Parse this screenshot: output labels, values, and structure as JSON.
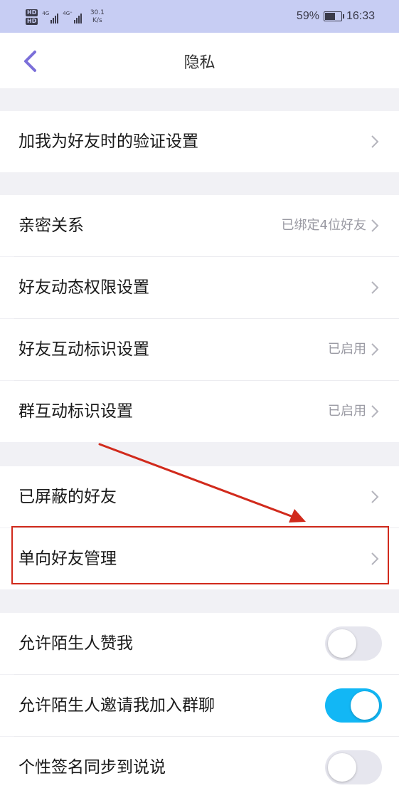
{
  "status_bar": {
    "hd1": "HD",
    "hd2": "HD",
    "sig1_label": "4G",
    "sig2_label": "4G⁺",
    "speed_value": "30.1",
    "speed_unit": "K/s",
    "battery_percent": "59%",
    "battery_level": 0.59,
    "time": "16:33"
  },
  "nav": {
    "back_icon": "chevron-left-icon",
    "title": "隐私"
  },
  "sections": [
    {
      "rows": [
        {
          "label": "加我为好友时的验证设置",
          "value": "",
          "control": "chevron"
        }
      ]
    },
    {
      "rows": [
        {
          "label": "亲密关系",
          "value": "已绑定4位好友",
          "control": "chevron"
        },
        {
          "label": "好友动态权限设置",
          "value": "",
          "control": "chevron"
        },
        {
          "label": "好友互动标识设置",
          "value": "已启用",
          "control": "chevron"
        },
        {
          "label": "群互动标识设置",
          "value": "已启用",
          "control": "chevron"
        }
      ]
    },
    {
      "rows": [
        {
          "label": "已屏蔽的好友",
          "value": "",
          "control": "chevron"
        },
        {
          "label": "单向好友管理",
          "value": "",
          "control": "chevron",
          "highlighted": true
        }
      ]
    },
    {
      "rows": [
        {
          "label": "允许陌生人赞我",
          "value": "",
          "control": "toggle",
          "on": false
        },
        {
          "label": "允许陌生人邀请我加入群聊",
          "value": "",
          "control": "toggle",
          "on": true
        },
        {
          "label": "个性签名同步到说说",
          "value": "",
          "control": "toggle",
          "on": false
        }
      ]
    }
  ],
  "colors": {
    "status_bar_bg": "#c7cdf3",
    "accent_back": "#7b6fd9",
    "toggle_on": "#12b7f5",
    "annotation_red": "#d12a1c"
  }
}
